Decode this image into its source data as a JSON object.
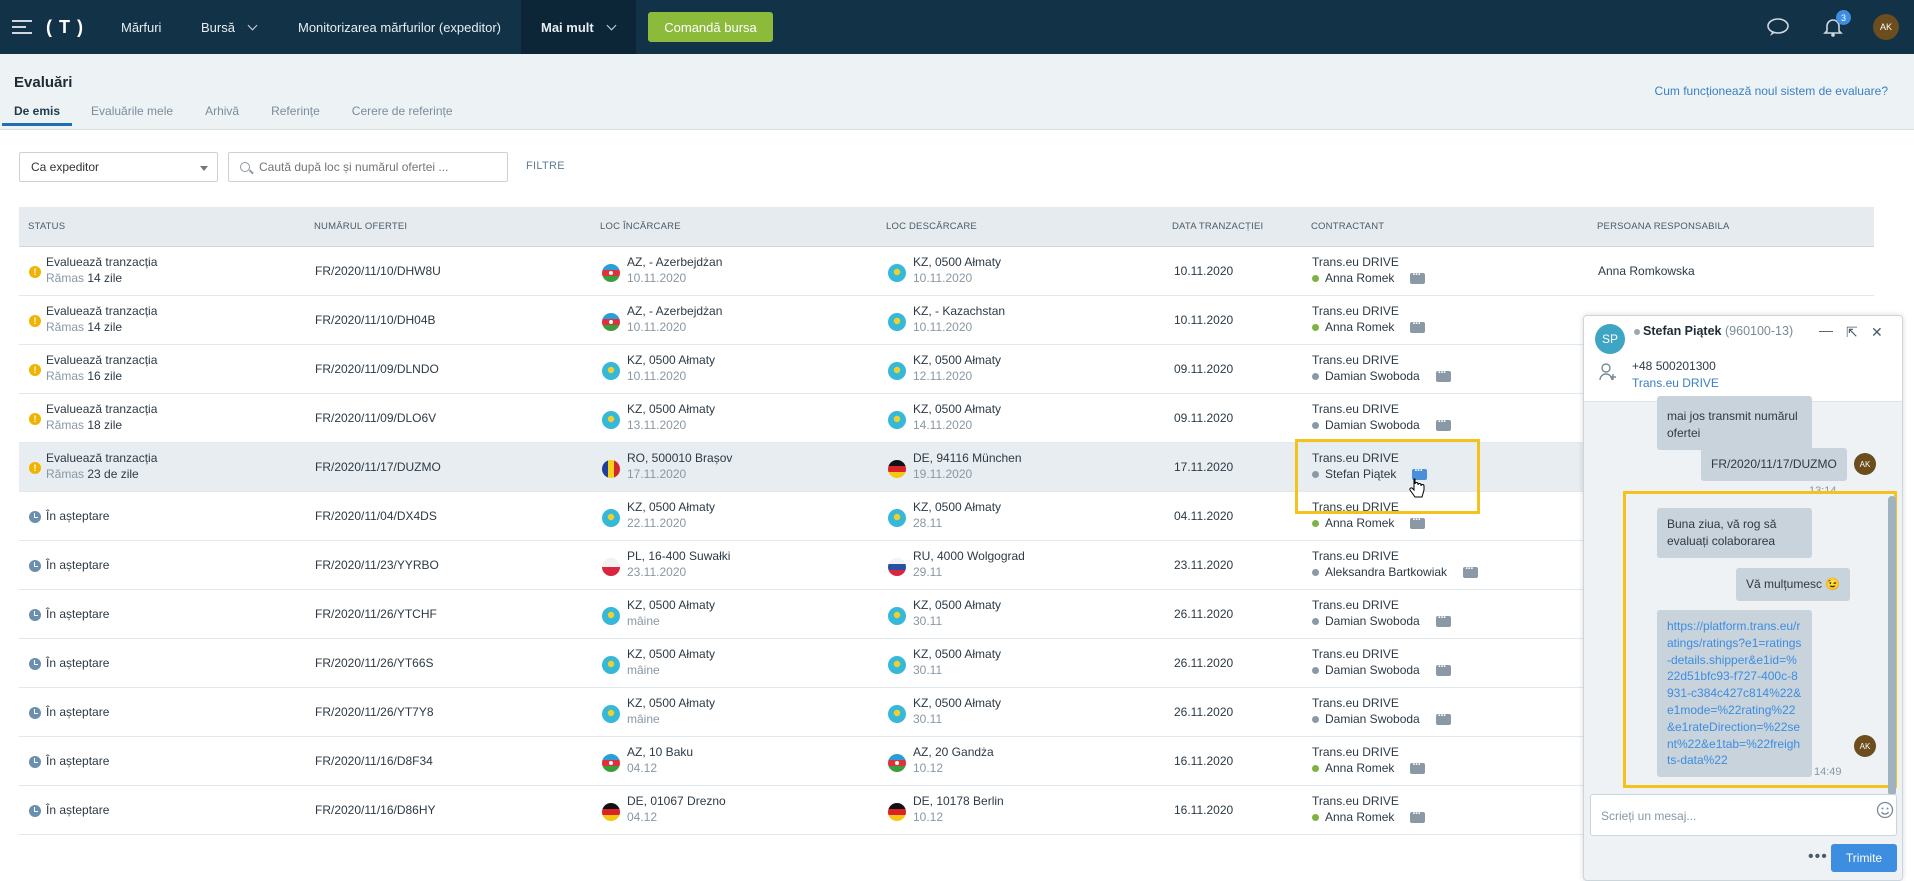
{
  "topbar": {
    "logo": "( T )",
    "nav": [
      "Mărfuri",
      "Bursă",
      "Monitorizarea mărfurilor (expeditor)",
      "Mai mult"
    ],
    "command_button": "Comandă bursa",
    "notifications_count": "3",
    "user_initials": "AK"
  },
  "header": {
    "title": "Evaluări",
    "tabs": [
      "De emis",
      "Evaluările mele",
      "Arhivă",
      "Referințe",
      "Cerere de referințe"
    ],
    "help_link": "Cum funcționează noul sistem de evaluare?"
  },
  "filters": {
    "role_select": "Ca expeditor",
    "search_placeholder": "Caută după loc și numărul ofertei ...",
    "filters_label": "FILTRE"
  },
  "table": {
    "columns": [
      "STATUS",
      "NUMĂRUL OFERTEI",
      "LOC ÎNCĂRCARE",
      "LOC DESCĂRCARE",
      "DATA TRANZACȚIEI",
      "CONTRACTANT",
      "PERSOANA RESPONSABILA"
    ],
    "rows": [
      {
        "status": "Evaluează tranzacția",
        "remain_a": "Rămas",
        "remain_b": "14 zile",
        "kind": "warn",
        "offer": "FR/2020/11/10/DHW8U",
        "load_flag": "az",
        "load": "AZ, - Azerbejdżan",
        "load_date": "10.11.2020",
        "unload_flag": "kz",
        "unload": "KZ, 0500 Ałmaty",
        "unload_date": "10.11.2020",
        "date": "10.11.2020",
        "company": "Trans.eu DRIVE",
        "person": "Anna Romek",
        "online": true,
        "responsible": "Anna Romkowska"
      },
      {
        "status": "Evaluează tranzacția",
        "remain_a": "Rămas",
        "remain_b": "14 zile",
        "kind": "warn",
        "offer": "FR/2020/11/10/DH04B",
        "load_flag": "az",
        "load": "AZ, - Azerbejdżan",
        "load_date": "10.11.2020",
        "unload_flag": "kz",
        "unload": "KZ, - Kazachstan",
        "unload_date": "10.11.2020",
        "date": "10.11.2020",
        "company": "Trans.eu DRIVE",
        "person": "Anna Romek",
        "online": true,
        "responsible": ""
      },
      {
        "status": "Evaluează tranzacția",
        "remain_a": "Rămas",
        "remain_b": "16 zile",
        "kind": "warn",
        "offer": "FR/2020/11/09/DLNDO",
        "load_flag": "kz",
        "load": "KZ, 0500 Ałmaty",
        "load_date": "10.11.2020",
        "unload_flag": "kz",
        "unload": "KZ, 0500 Ałmaty",
        "unload_date": "12.11.2020",
        "date": "09.11.2020",
        "company": "Trans.eu DRIVE",
        "person": "Damian Swoboda",
        "online": false,
        "responsible": ""
      },
      {
        "status": "Evaluează tranzacția",
        "remain_a": "Rămas",
        "remain_b": "18 zile",
        "kind": "warn",
        "offer": "FR/2020/11/09/DLO6V",
        "load_flag": "kz",
        "load": "KZ, 0500 Ałmaty",
        "load_date": "13.11.2020",
        "unload_flag": "kz",
        "unload": "KZ, 0500 Ałmaty",
        "unload_date": "14.11.2020",
        "date": "09.11.2020",
        "company": "Trans.eu DRIVE",
        "person": "Damian Swoboda",
        "online": false,
        "responsible": ""
      },
      {
        "status": "Evaluează tranzacția",
        "remain_a": "Rămas",
        "remain_b": "23 de zile",
        "kind": "warn",
        "offer": "FR/2020/11/17/DUZMO",
        "load_flag": "ro",
        "load": "RO, 500010 Brașov",
        "load_date": "17.11.2020",
        "unload_flag": "de",
        "unload": "DE, 94116 München",
        "unload_date": "19.11.2020",
        "date": "17.11.2020",
        "company": "Trans.eu DRIVE",
        "person": "Stefan Piątek",
        "online": false,
        "responsible": ""
      },
      {
        "status": "În așteptare",
        "remain_a": "",
        "remain_b": "",
        "kind": "wait",
        "offer": "FR/2020/11/04/DX4DS",
        "load_flag": "kz",
        "load": "KZ, 0500 Ałmaty",
        "load_date": "22.11.2020",
        "unload_flag": "kz",
        "unload": "KZ, 0500 Ałmaty",
        "unload_date": "28.11",
        "date": "04.11.2020",
        "company": "Trans.eu DRIVE",
        "person": "Anna Romek",
        "online": true,
        "responsible": ""
      },
      {
        "status": "În așteptare",
        "remain_a": "",
        "remain_b": "",
        "kind": "wait",
        "offer": "FR/2020/11/23/YYRBO",
        "load_flag": "pl",
        "load": "PL, 16-400 Suwałki",
        "load_date": "23.11.2020",
        "unload_flag": "ru",
        "unload": "RU, 4000 Wolgograd",
        "unload_date": "29.11",
        "date": "23.11.2020",
        "company": "Trans.eu DRIVE",
        "person": "Aleksandra Bartkowiak",
        "online": false,
        "responsible": ""
      },
      {
        "status": "În așteptare",
        "remain_a": "",
        "remain_b": "",
        "kind": "wait",
        "offer": "FR/2020/11/26/YTCHF",
        "load_flag": "kz",
        "load": "KZ, 0500 Ałmaty",
        "load_date": "mâine",
        "unload_flag": "kz",
        "unload": "KZ, 0500 Ałmaty",
        "unload_date": "30.11",
        "date": "26.11.2020",
        "company": "Trans.eu DRIVE",
        "person": "Damian Swoboda",
        "online": false,
        "responsible": ""
      },
      {
        "status": "În așteptare",
        "remain_a": "",
        "remain_b": "",
        "kind": "wait",
        "offer": "FR/2020/11/26/YT66S",
        "load_flag": "kz",
        "load": "KZ, 0500 Ałmaty",
        "load_date": "mâine",
        "unload_flag": "kz",
        "unload": "KZ, 0500 Ałmaty",
        "unload_date": "30.11",
        "date": "26.11.2020",
        "company": "Trans.eu DRIVE",
        "person": "Damian Swoboda",
        "online": false,
        "responsible": ""
      },
      {
        "status": "În așteptare",
        "remain_a": "",
        "remain_b": "",
        "kind": "wait",
        "offer": "FR/2020/11/26/YT7Y8",
        "load_flag": "kz",
        "load": "KZ, 0500 Ałmaty",
        "load_date": "mâine",
        "unload_flag": "kz",
        "unload": "KZ, 0500 Ałmaty",
        "unload_date": "30.11",
        "date": "26.11.2020",
        "company": "Trans.eu DRIVE",
        "person": "Damian Swoboda",
        "online": false,
        "responsible": ""
      },
      {
        "status": "În așteptare",
        "remain_a": "",
        "remain_b": "",
        "kind": "wait",
        "offer": "FR/2020/11/16/D8F34",
        "load_flag": "az",
        "load": "AZ, 10 Baku",
        "load_date": "04.12",
        "unload_flag": "az",
        "unload": "AZ, 20 Gandża",
        "unload_date": "10.12",
        "date": "16.11.2020",
        "company": "Trans.eu DRIVE",
        "person": "Anna Romek",
        "online": true,
        "responsible": ""
      },
      {
        "status": "În așteptare",
        "remain_a": "",
        "remain_b": "",
        "kind": "wait",
        "offer": "FR/2020/11/16/D86HY",
        "load_flag": "de",
        "load": "DE, 01067 Drezno",
        "load_date": "04.12",
        "unload_flag": "de",
        "unload": "DE, 10178 Berlin",
        "unload_date": "10.12",
        "date": "16.11.2020",
        "company": "Trans.eu DRIVE",
        "person": "Anna Romek",
        "online": true,
        "responsible": ""
      }
    ]
  },
  "chat": {
    "initials": "SP",
    "name": "Stefan Piątek",
    "id": "(960100-13)",
    "phone": "+48 500201300",
    "company": "Trans.eu DRIVE",
    "msg_partial": "mai jos transmit numărul ofertei",
    "msg_offer": "FR/2020/11/17/DUZMO",
    "time_partial": "13:14",
    "msg_hello": "Buna ziua, vă rog să evaluați colaborarea",
    "msg_thanks": "Vă mulțumesc 😉",
    "msg_link": "https://platform.trans.eu/ratings/ratings?e1=ratings-details.shipper&e1id=%22d51bfc93-f727-400c-8931-c384c427c814%22&e1mode=%22rating%22&e1rateDirection=%22sent%22&e1tab=%22freights-data%22",
    "time_last": "14:49",
    "input_placeholder": "Scrieți un mesaj...",
    "send": "Trimite",
    "my_initials": "AK"
  },
  "colors": {
    "topbar": "#123247",
    "accent_green": "#8cbb3c",
    "highlight": "#f4c21a",
    "link": "#3d8de0"
  }
}
